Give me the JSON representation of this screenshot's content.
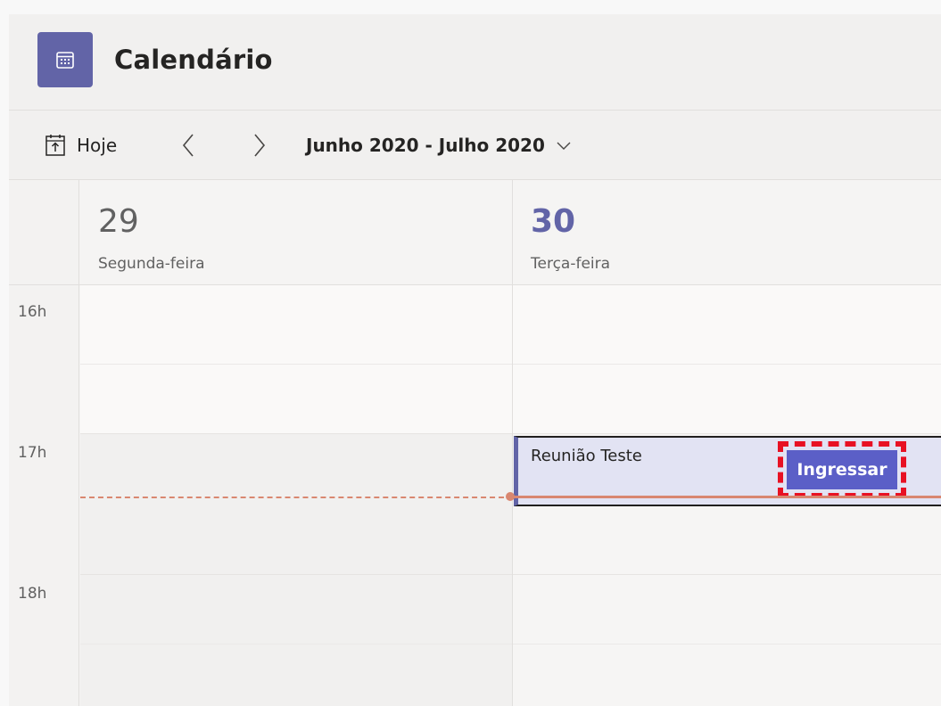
{
  "app": {
    "title": "Calendário",
    "icon": "calendar-icon",
    "accent_color": "#6264a7"
  },
  "toolbar": {
    "today_label": "Hoje",
    "today_icon": "today-calendar-icon",
    "prev_icon": "chevron-left-icon",
    "next_icon": "chevron-right-icon",
    "date_range": "Junho 2020 - Julho 2020",
    "date_range_icon": "chevron-down-icon"
  },
  "days": [
    {
      "number": "29",
      "name": "Segunda-feira",
      "is_today": false
    },
    {
      "number": "30",
      "name": "Terça-feira",
      "is_today": true
    }
  ],
  "hours": [
    "16h",
    "17h",
    "18h"
  ],
  "event": {
    "title": "Reunião Teste",
    "join_label": "Ingressar",
    "highlight_color": "#e81123"
  },
  "current_time_color": "#d98770"
}
